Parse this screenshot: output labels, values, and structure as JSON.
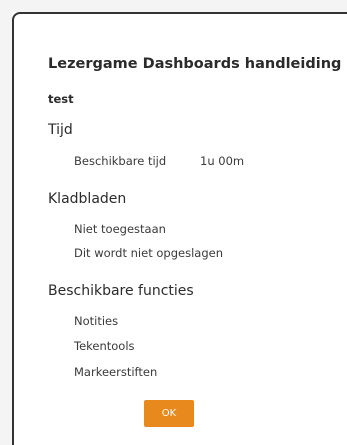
{
  "dialog": {
    "title": "Lezergame Dashboards handleiding",
    "subtitle": "test",
    "time_section": {
      "heading": "Tijd",
      "label": "Beschikbare tijd",
      "value": "1u 00m"
    },
    "scratchpad_section": {
      "heading": "Kladbladen",
      "items": [
        "Niet toegestaan",
        "Dit wordt niet opgeslagen"
      ]
    },
    "functions_section": {
      "heading": "Beschikbare functies",
      "items": [
        "Notities",
        "Tekentools",
        "Markeerstiften"
      ]
    },
    "ok_label": "OK"
  },
  "colors": {
    "accent": "#e8891d",
    "text": "#333333",
    "background": "#ffffff"
  }
}
